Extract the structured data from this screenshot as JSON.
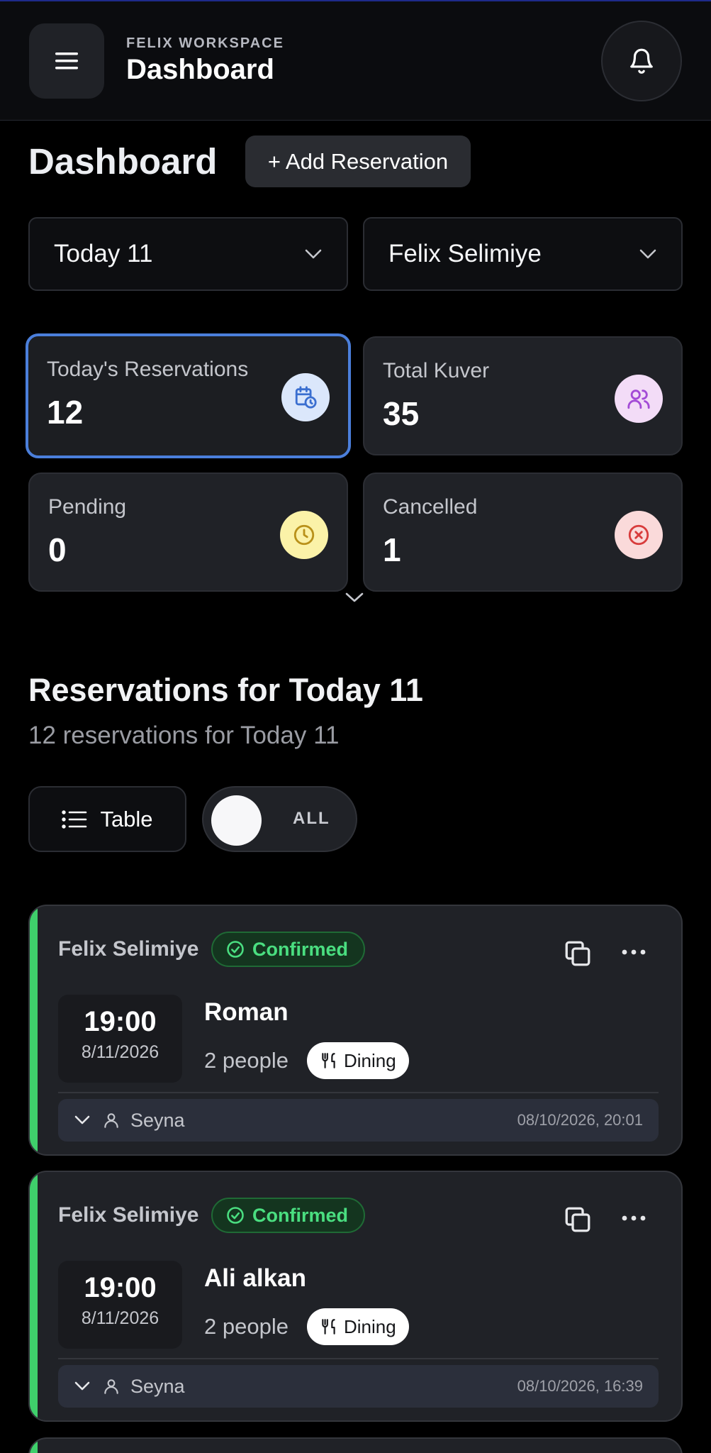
{
  "header": {
    "workspace_label": "FELIX WORKSPACE",
    "title": "Dashboard"
  },
  "page": {
    "title": "Dashboard",
    "add_button_label": "+ Add Reservation"
  },
  "filters": {
    "date_value": "Today 11",
    "venue_value": "Felix Selimiye"
  },
  "stats": [
    {
      "label": "Today's Reservations",
      "value": "12",
      "icon": "calendar-clock-icon",
      "color": "#4b7fdb"
    },
    {
      "label": "Total Kuver",
      "value": "35",
      "icon": "users-icon",
      "color": "#a34bd6"
    },
    {
      "label": "Pending",
      "value": "0",
      "icon": "clock-icon",
      "color": "#b9911a"
    },
    {
      "label": "Cancelled",
      "value": "1",
      "icon": "x-circle-icon",
      "color": "#d83c3c"
    }
  ],
  "section": {
    "title": "Reservations for Today 11",
    "subtitle": "12 reservations for Today 11"
  },
  "controls": {
    "view_label": "Table",
    "toggle_label": "ALL"
  },
  "reservations": [
    {
      "venue": "Felix Selimiye",
      "status": "Confirmed",
      "time": "19:00",
      "date": "8/11/2026",
      "guest": "Roman",
      "people": "2 people",
      "type": "Dining",
      "staff": "Seyna",
      "created": "08/10/2026, 20:01"
    },
    {
      "venue": "Felix Selimiye",
      "status": "Confirmed",
      "time": "19:00",
      "date": "8/11/2026",
      "guest": "Ali alkan",
      "people": "2 people",
      "type": "Dining",
      "staff": "Seyna",
      "created": "08/10/2026, 16:39"
    }
  ],
  "colors": {
    "accent": "#4b7fdb",
    "confirmed": "#4ade80",
    "card_accent": "#3fcf6b"
  }
}
